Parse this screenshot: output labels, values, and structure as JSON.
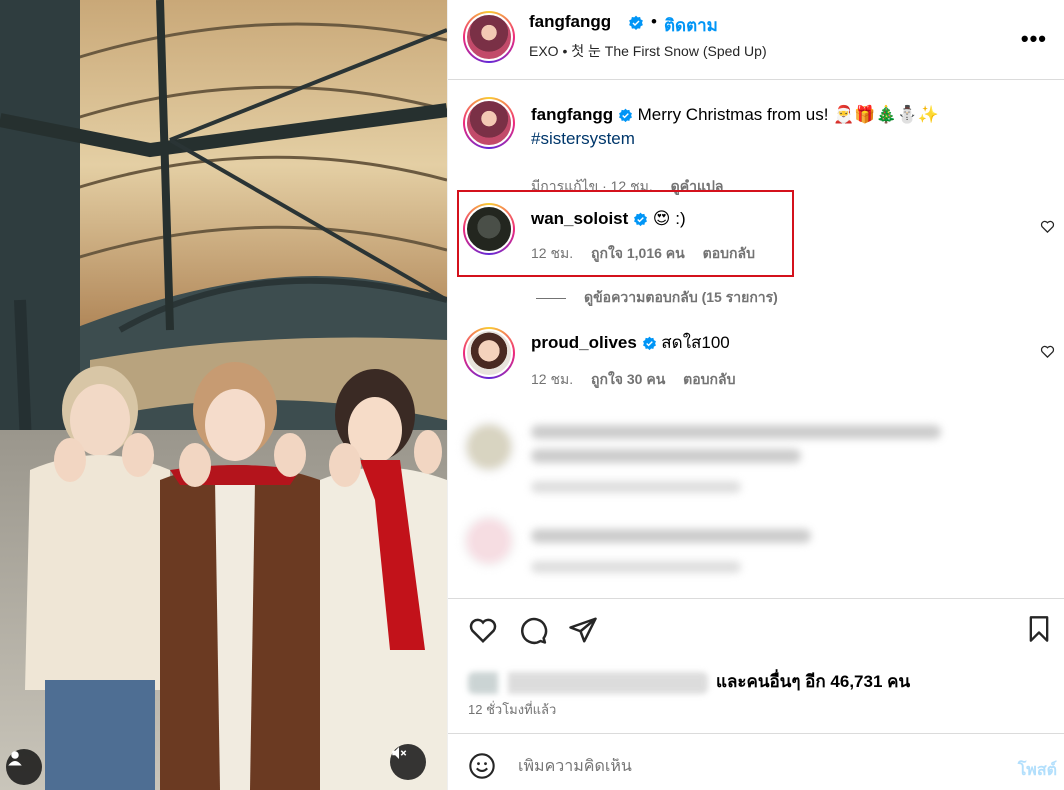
{
  "post": {
    "username": "fangfangg",
    "dot": "•",
    "follow_label": "ติดตาม",
    "audio": "EXO • 첫 눈 The First Snow (Sped Up)",
    "more_icon": "more-options-icon"
  },
  "caption": {
    "username": "fangfangg",
    "text": "Merry Christmas from us! 🎅🎁🎄⛄✨",
    "hashtag": "#sistersystem",
    "edited": "มีการแก้ไข · 12 ชม.",
    "translate": "ดูคำแปล"
  },
  "comments": [
    {
      "username": "wan_soloist",
      "text": "😍 :)",
      "time": "12 ชม.",
      "likes": "ถูกใจ 1,016 คน",
      "reply": "ตอบกลับ"
    },
    {
      "username": "proud_olives",
      "text": "สดใส100",
      "time": "12 ชม.",
      "likes": "ถูกใจ 30 คน",
      "reply": "ตอบกลับ"
    }
  ],
  "view_replies": "ดูข้อความตอบกลับ (15 รายการ)",
  "likes_summary": "และคนอื่นๆ อีก 46,731 คน",
  "time_ago": "12 ชั่วโมงที่แล้ว",
  "add_comment": {
    "placeholder": "เพิ่มความคิดเห็น",
    "post_label": "โพสต์"
  },
  "colors": {
    "accent": "#0095f6",
    "highlight_box": "#d4111c",
    "muted": "#737373"
  }
}
